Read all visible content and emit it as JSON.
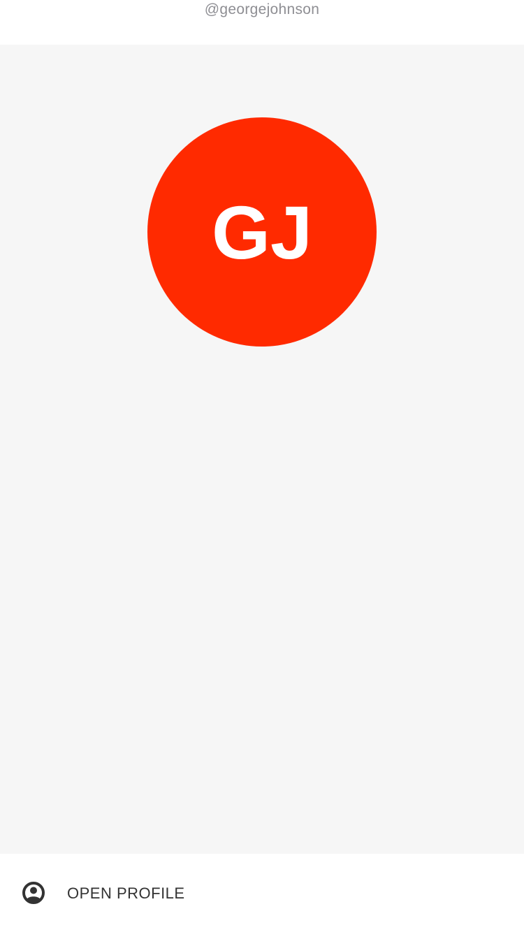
{
  "header": {
    "username": "@georgejohnson"
  },
  "profile": {
    "initials": "GJ",
    "avatar_color": "#ff2a00"
  },
  "actions": {
    "open_profile_label": "OPEN PROFILE",
    "open_profile_icon": "account-circle-icon"
  },
  "colors": {
    "background": "#f6f6f6",
    "surface": "#ffffff",
    "muted_text": "#8e8e93",
    "text": "#333333"
  }
}
